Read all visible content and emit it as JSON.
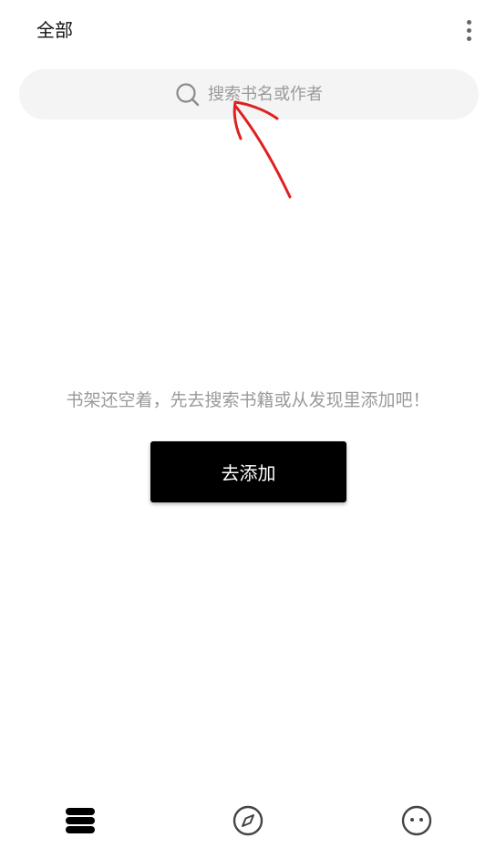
{
  "header": {
    "title": "全部",
    "more_icon": "more-vertical-icon"
  },
  "search": {
    "placeholder": "搜索书名或作者",
    "icon": "search-icon"
  },
  "empty_state": {
    "message": "书架还空着，先去搜索书籍或从发现里添加吧！",
    "button_label": "去添加"
  },
  "bottom_nav": {
    "items": [
      {
        "name": "bookshelf",
        "icon": "bookshelf-icon",
        "active": true
      },
      {
        "name": "discover",
        "icon": "compass-icon",
        "active": false
      },
      {
        "name": "profile",
        "icon": "face-icon",
        "active": false
      }
    ]
  },
  "colors": {
    "background": "#ffffff",
    "search_bg": "#f4f4f4",
    "placeholder": "#9a9a9a",
    "button_bg": "#000000",
    "button_text": "#ffffff",
    "annotation": "#e02020"
  }
}
